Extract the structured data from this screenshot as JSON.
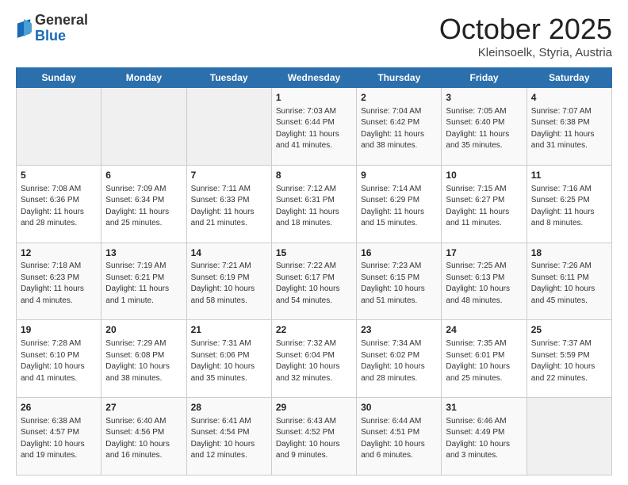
{
  "header": {
    "logo_general": "General",
    "logo_blue": "Blue",
    "month_title": "October 2025",
    "location": "Kleinsoelk, Styria, Austria"
  },
  "days_of_week": [
    "Sunday",
    "Monday",
    "Tuesday",
    "Wednesday",
    "Thursday",
    "Friday",
    "Saturday"
  ],
  "weeks": [
    [
      {
        "day": "",
        "info": ""
      },
      {
        "day": "",
        "info": ""
      },
      {
        "day": "",
        "info": ""
      },
      {
        "day": "1",
        "info": "Sunrise: 7:03 AM\nSunset: 6:44 PM\nDaylight: 11 hours and 41 minutes."
      },
      {
        "day": "2",
        "info": "Sunrise: 7:04 AM\nSunset: 6:42 PM\nDaylight: 11 hours and 38 minutes."
      },
      {
        "day": "3",
        "info": "Sunrise: 7:05 AM\nSunset: 6:40 PM\nDaylight: 11 hours and 35 minutes."
      },
      {
        "day": "4",
        "info": "Sunrise: 7:07 AM\nSunset: 6:38 PM\nDaylight: 11 hours and 31 minutes."
      }
    ],
    [
      {
        "day": "5",
        "info": "Sunrise: 7:08 AM\nSunset: 6:36 PM\nDaylight: 11 hours and 28 minutes."
      },
      {
        "day": "6",
        "info": "Sunrise: 7:09 AM\nSunset: 6:34 PM\nDaylight: 11 hours and 25 minutes."
      },
      {
        "day": "7",
        "info": "Sunrise: 7:11 AM\nSunset: 6:33 PM\nDaylight: 11 hours and 21 minutes."
      },
      {
        "day": "8",
        "info": "Sunrise: 7:12 AM\nSunset: 6:31 PM\nDaylight: 11 hours and 18 minutes."
      },
      {
        "day": "9",
        "info": "Sunrise: 7:14 AM\nSunset: 6:29 PM\nDaylight: 11 hours and 15 minutes."
      },
      {
        "day": "10",
        "info": "Sunrise: 7:15 AM\nSunset: 6:27 PM\nDaylight: 11 hours and 11 minutes."
      },
      {
        "day": "11",
        "info": "Sunrise: 7:16 AM\nSunset: 6:25 PM\nDaylight: 11 hours and 8 minutes."
      }
    ],
    [
      {
        "day": "12",
        "info": "Sunrise: 7:18 AM\nSunset: 6:23 PM\nDaylight: 11 hours and 4 minutes."
      },
      {
        "day": "13",
        "info": "Sunrise: 7:19 AM\nSunset: 6:21 PM\nDaylight: 11 hours and 1 minute."
      },
      {
        "day": "14",
        "info": "Sunrise: 7:21 AM\nSunset: 6:19 PM\nDaylight: 10 hours and 58 minutes."
      },
      {
        "day": "15",
        "info": "Sunrise: 7:22 AM\nSunset: 6:17 PM\nDaylight: 10 hours and 54 minutes."
      },
      {
        "day": "16",
        "info": "Sunrise: 7:23 AM\nSunset: 6:15 PM\nDaylight: 10 hours and 51 minutes."
      },
      {
        "day": "17",
        "info": "Sunrise: 7:25 AM\nSunset: 6:13 PM\nDaylight: 10 hours and 48 minutes."
      },
      {
        "day": "18",
        "info": "Sunrise: 7:26 AM\nSunset: 6:11 PM\nDaylight: 10 hours and 45 minutes."
      }
    ],
    [
      {
        "day": "19",
        "info": "Sunrise: 7:28 AM\nSunset: 6:10 PM\nDaylight: 10 hours and 41 minutes."
      },
      {
        "day": "20",
        "info": "Sunrise: 7:29 AM\nSunset: 6:08 PM\nDaylight: 10 hours and 38 minutes."
      },
      {
        "day": "21",
        "info": "Sunrise: 7:31 AM\nSunset: 6:06 PM\nDaylight: 10 hours and 35 minutes."
      },
      {
        "day": "22",
        "info": "Sunrise: 7:32 AM\nSunset: 6:04 PM\nDaylight: 10 hours and 32 minutes."
      },
      {
        "day": "23",
        "info": "Sunrise: 7:34 AM\nSunset: 6:02 PM\nDaylight: 10 hours and 28 minutes."
      },
      {
        "day": "24",
        "info": "Sunrise: 7:35 AM\nSunset: 6:01 PM\nDaylight: 10 hours and 25 minutes."
      },
      {
        "day": "25",
        "info": "Sunrise: 7:37 AM\nSunset: 5:59 PM\nDaylight: 10 hours and 22 minutes."
      }
    ],
    [
      {
        "day": "26",
        "info": "Sunrise: 6:38 AM\nSunset: 4:57 PM\nDaylight: 10 hours and 19 minutes."
      },
      {
        "day": "27",
        "info": "Sunrise: 6:40 AM\nSunset: 4:56 PM\nDaylight: 10 hours and 16 minutes."
      },
      {
        "day": "28",
        "info": "Sunrise: 6:41 AM\nSunset: 4:54 PM\nDaylight: 10 hours and 12 minutes."
      },
      {
        "day": "29",
        "info": "Sunrise: 6:43 AM\nSunset: 4:52 PM\nDaylight: 10 hours and 9 minutes."
      },
      {
        "day": "30",
        "info": "Sunrise: 6:44 AM\nSunset: 4:51 PM\nDaylight: 10 hours and 6 minutes."
      },
      {
        "day": "31",
        "info": "Sunrise: 6:46 AM\nSunset: 4:49 PM\nDaylight: 10 hours and 3 minutes."
      },
      {
        "day": "",
        "info": ""
      }
    ]
  ]
}
